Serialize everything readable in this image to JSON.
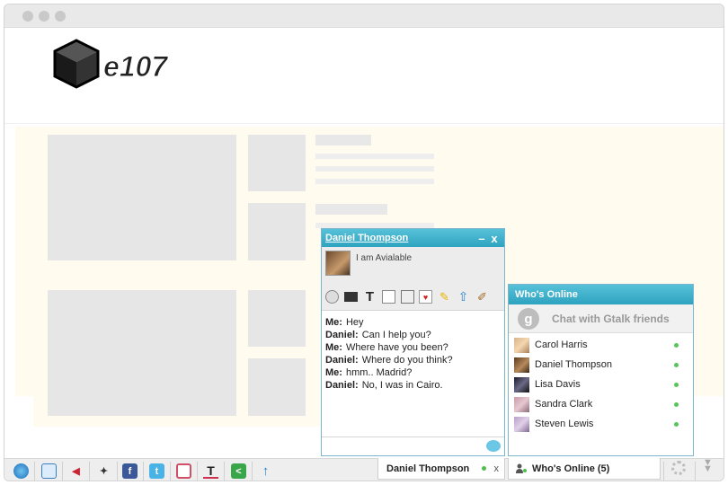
{
  "site": {
    "logo_text": "e107"
  },
  "chat": {
    "contact_name": "Daniel Thompson",
    "status_message": "I am Avialable",
    "minimize_label": "–",
    "close_label": "x",
    "messages": [
      {
        "sender": "Me:",
        "text": "Hey"
      },
      {
        "sender": "Daniel:",
        "text": "Can I help you?"
      },
      {
        "sender": "Me:",
        "text": "Where have you been?"
      },
      {
        "sender": "Daniel:",
        "text": "Where do you think?"
      },
      {
        "sender": "Me:",
        "text": "hmm.. Madrid?"
      },
      {
        "sender": "Daniel:",
        "text": "No, I was in Cairo."
      }
    ],
    "input_value": "",
    "tab_label": "Daniel Thompson",
    "tab_close": "x"
  },
  "whos_online": {
    "header": "Who's Online",
    "gtalk_label": "Chat with Gtalk friends",
    "gtalk_icon": "g",
    "friends": [
      {
        "name": "Carol Harris",
        "status": "online"
      },
      {
        "name": "Daniel Thompson",
        "status": "online"
      },
      {
        "name": "Lisa Davis",
        "status": "online"
      },
      {
        "name": "Sandra Clark",
        "status": "online"
      },
      {
        "name": "Steven Lewis",
        "status": "online"
      }
    ],
    "tab_label": "Who's Online (5)"
  },
  "toolbar_icons": [
    "globe-icon",
    "video-icon",
    "megaphone-icon",
    "space-invader-icon",
    "facebook-icon",
    "twitter-icon",
    "square-icon",
    "text-icon",
    "share-icon",
    "upload-icon"
  ],
  "bottom_icons": {
    "facebook": "f",
    "twitter": "t",
    "text": "T",
    "upload": "↑"
  },
  "colors": {
    "accent": "#3ab0cb",
    "online": "#58c558"
  }
}
